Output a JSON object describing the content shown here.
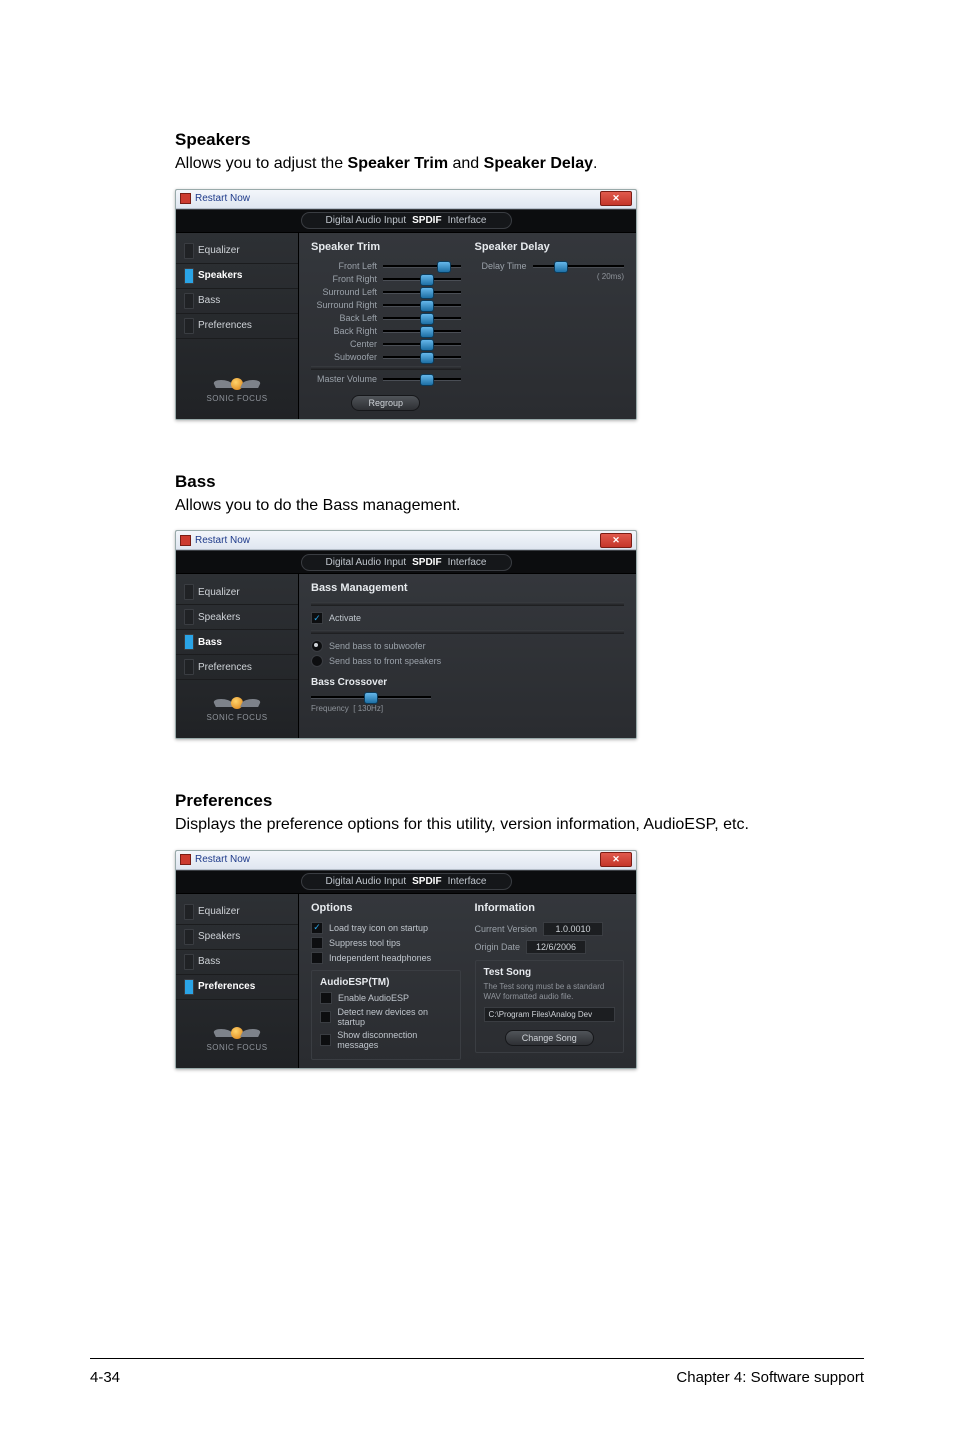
{
  "sections": {
    "speakers": {
      "title": "Speakers",
      "desc_pre": "Allows you to adjust the ",
      "desc_b1": "Speaker Trim",
      "desc_mid": " and ",
      "desc_b2": "Speaker Delay",
      "desc_post": "."
    },
    "bass": {
      "title": "Bass",
      "desc": "Allows you to do the Bass management."
    },
    "prefs": {
      "title": "Preferences",
      "desc": "Displays the preference options for this utility, version information, AudioESP, etc."
    }
  },
  "common": {
    "window_title": "Restart Now",
    "header_pre": "Digital Audio Input",
    "header_spdif": "SPDIF",
    "header_post": " Interface",
    "nav": {
      "equalizer": "Equalizer",
      "speakers": "Speakers",
      "bass": "Bass",
      "preferences": "Preferences"
    },
    "logo_text": "SONIC FOCUS"
  },
  "speakers_panel": {
    "trim_title": "Speaker Trim",
    "delay_title": "Speaker Delay",
    "trim": {
      "front_left": "Front Left",
      "front_right": "Front Right",
      "surround_left": "Surround Left",
      "surround_right": "Surround Right",
      "back_left": "Back Left",
      "back_right": "Back Right",
      "center": "Center",
      "subwoofer": "Subwoofer",
      "master": "Master Volume"
    },
    "delay": {
      "label": "Delay Time",
      "unit": "( 20ms)"
    },
    "regroup_btn": "Regroup"
  },
  "bass_panel": {
    "title": "Bass Management",
    "activate": "Activate",
    "send_sub": "Send bass to subwoofer",
    "send_front": "Send bass to front speakers",
    "crossover_title": "Bass Crossover",
    "freq_label": "Frequency",
    "freq_value": "[ 130Hz]"
  },
  "prefs_panel": {
    "options_title": "Options",
    "opt_tray": "Load tray icon on startup",
    "opt_suppress": "Suppress tool tips",
    "opt_indep": "Independent headphones",
    "esp_title": "AudioESP(TM)",
    "esp_enable": "Enable AudioESP",
    "esp_detect": "Detect new devices on startup",
    "esp_show": "Show disconnection messages",
    "info_title": "Information",
    "ver_label": "Current Version",
    "ver_value": "1.0.0010",
    "date_label": "Origin Date",
    "date_value": "12/6/2006",
    "test_title": "Test Song",
    "test_desc": "The Test song must be a standard WAV formatted audio file.",
    "test_path": "C:\\Program Files\\Analog Dev",
    "change_btn": "Change Song"
  },
  "footer": {
    "page": "4-34",
    "chapter": "Chapter 4: Software support"
  }
}
